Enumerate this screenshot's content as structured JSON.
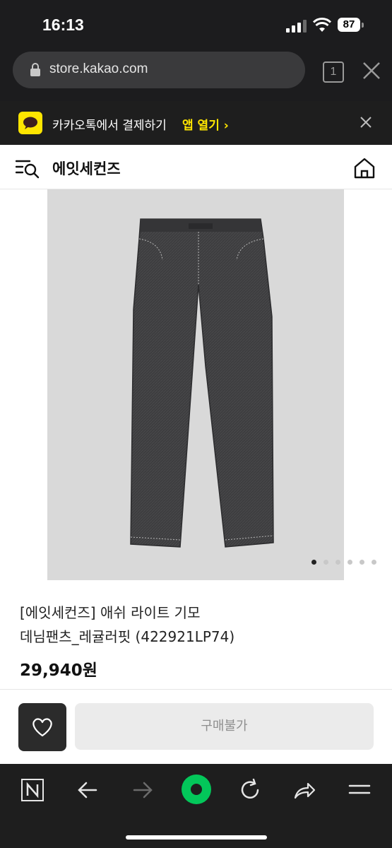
{
  "status_bar": {
    "time": "16:13",
    "battery": "87"
  },
  "browser": {
    "url": "store.kakao.com",
    "tab_count": "1"
  },
  "banner": {
    "text": "카카오톡에서 결제하기",
    "link": "앱 열기 ›"
  },
  "header": {
    "brand": "에잇세컨즈"
  },
  "product": {
    "title_line1": "[에잇세컨즈] 애쉬 라이트 기모",
    "title_line2": "데님팬츠_레귤러핏 (422921LP74)",
    "price": "29,940원",
    "image_count": 6,
    "current_image": 1
  },
  "actions": {
    "buy_label": "구매불가"
  },
  "icons": {
    "menu": "search-list-icon",
    "home": "home-icon",
    "wish": "heart-icon",
    "toolbar": [
      "naver-n-icon",
      "back-arrow-icon",
      "forward-arrow-icon",
      "green-dot-icon",
      "refresh-icon",
      "share-icon",
      "hamburger-icon"
    ]
  },
  "colors": {
    "kakao_yellow": "#fee500",
    "naver_green": "#03c75a",
    "dark": "#1c1c1e"
  }
}
